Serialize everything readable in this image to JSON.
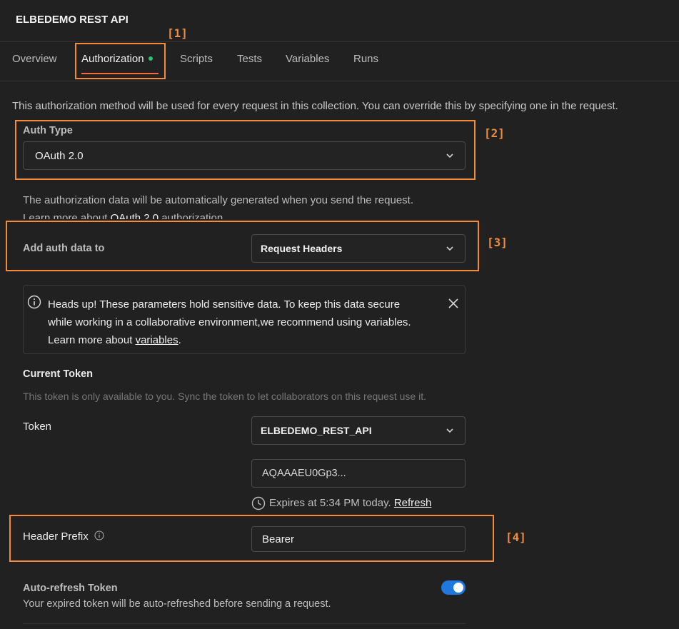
{
  "collection_title": "ELBEDEMO REST API",
  "tabs": [
    {
      "label": "Overview"
    },
    {
      "label": "Authorization"
    },
    {
      "label": "Scripts"
    },
    {
      "label": "Tests"
    },
    {
      "label": "Variables"
    },
    {
      "label": "Runs"
    }
  ],
  "annotations": [
    "[1]",
    "[2]",
    "[3]",
    "[4]"
  ],
  "description": "This authorization method will be used for every request in this collection. You can override this by specifying one in the request.",
  "auth_type": {
    "label": "Auth Type",
    "value": "OAuth 2.0"
  },
  "auth_info": {
    "line1": "The authorization data will be automatically generated when you send the request.",
    "line2_prefix": "Learn more about ",
    "line2_link": "OAuth 2.0",
    "line2_suffix": " authorization"
  },
  "add_auth_data": {
    "label": "Add auth data to",
    "value": "Request Headers"
  },
  "heads_up": {
    "line1": "Heads up! These parameters hold sensitive data. To keep this data secure",
    "line2": "while working in a collaborative environment,we recommend using variables.",
    "line3_prefix": "Learn more about ",
    "line3_link": "variables",
    "line3_suffix": "."
  },
  "current_token": {
    "heading": "Current Token",
    "note": "This token is only available to you. Sync the token to let collaborators on this request use it.",
    "token_label": "Token",
    "token_name": "ELBEDEMO_REST_API",
    "token_value": "AQAAAEU0Gp3...",
    "expires_text": "Expires at 5:34 PM today.",
    "refresh_label": "Refresh"
  },
  "header_prefix": {
    "label": "Header Prefix",
    "value": "Bearer"
  },
  "auto_refresh": {
    "title": "Auto-refresh Token",
    "description": "Your expired token will be auto-refreshed before sending a request.",
    "enabled": true
  },
  "colors": {
    "annotation": "#f28b3c",
    "active_tab_underline": "#f26b3a",
    "status_dot": "#29c46f",
    "toggle_on": "#1f77e0"
  }
}
